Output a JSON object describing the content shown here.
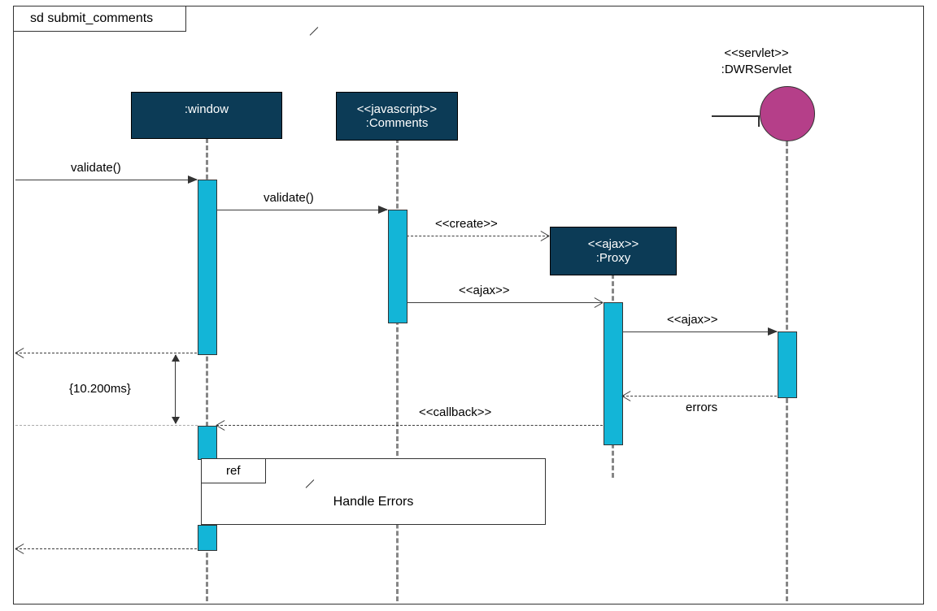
{
  "frame": {
    "title": "sd submit_comments"
  },
  "participants": {
    "window": {
      "line1": "",
      "line2": ":window"
    },
    "comments": {
      "line1": "<<javascript>>",
      "line2": ":Comments"
    },
    "proxy": {
      "line1": "<<ajax>>",
      "line2": ":Proxy"
    },
    "servlet": {
      "line1": "<<servlet>>",
      "line2": ":DWRServlet"
    }
  },
  "messages": {
    "m1": "validate()",
    "m2": "validate()",
    "m3": "<<create>>",
    "m4": "<<ajax>>",
    "m5": "<<ajax>>",
    "m6": "errors",
    "m7": "<<callback>>"
  },
  "constraint": "{10.200ms}",
  "ref": {
    "label": "ref",
    "content": "Handle Errors"
  }
}
